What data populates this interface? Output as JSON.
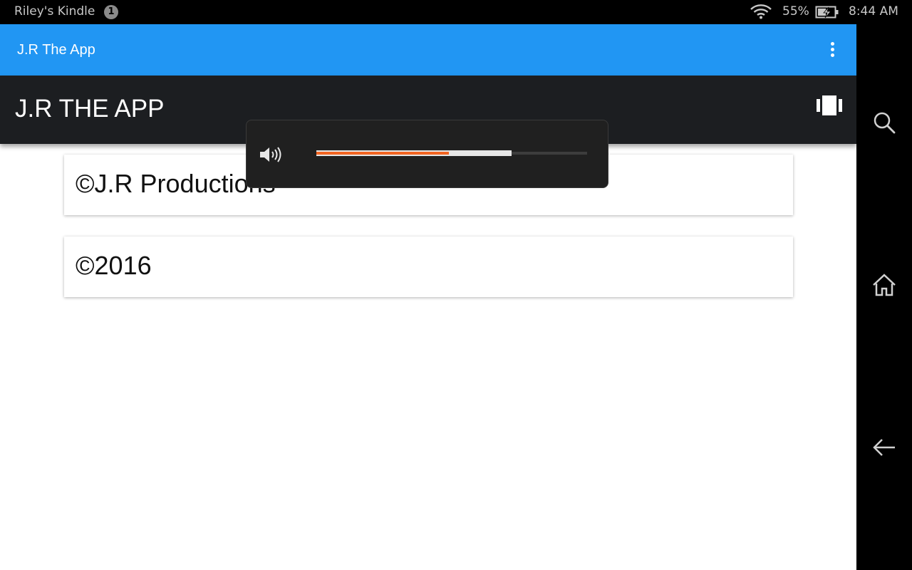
{
  "status_bar": {
    "device_name": "Riley's Kindle",
    "notification_count": "1",
    "battery_percent": "55%",
    "time": "8:44 AM",
    "icons": [
      "wifi-icon",
      "battery-charging-icon"
    ]
  },
  "app_bar": {
    "title": "J.R The App",
    "menu_icon": "more-vertical-icon",
    "color": "#2196f3"
  },
  "toolbar": {
    "title": "J.R THE APP",
    "action_icon": "carousel-icon",
    "color": "#1c1e21"
  },
  "cards": [
    {
      "text": "©J.R Productions"
    },
    {
      "text": "©2016"
    }
  ],
  "volume_overlay": {
    "icon": "volume-icon",
    "level": 0.49,
    "buffer": 0.72,
    "accent": "#f26522"
  },
  "nav_bar": {
    "buttons": [
      "search-icon",
      "home-icon",
      "back-icon"
    ]
  }
}
